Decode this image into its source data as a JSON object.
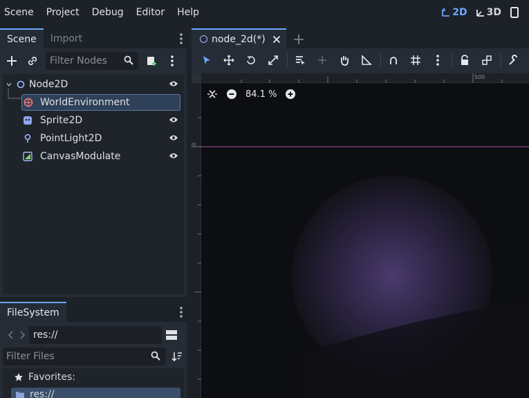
{
  "menu": [
    "Scene",
    "Project",
    "Debug",
    "Editor",
    "Help"
  ],
  "view_modes": {
    "two_d": "2D",
    "three_d": "3D"
  },
  "scene_dock": {
    "tabs": [
      "Scene",
      "Import"
    ],
    "filter_placeholder": "Filter Nodes",
    "nodes": [
      {
        "label": "Node2D",
        "icon": "node2d-icon",
        "visible": true
      },
      {
        "label": "WorldEnvironment",
        "icon": "world-environment-icon",
        "selected": true
      },
      {
        "label": "Sprite2D",
        "icon": "sprite2d-icon",
        "visible": true
      },
      {
        "label": "PointLight2D",
        "icon": "pointlight2d-icon",
        "visible": true
      },
      {
        "label": "CanvasModulate",
        "icon": "canvasmodulate-icon",
        "visible": true
      }
    ]
  },
  "filesystem": {
    "tab": "FileSystem",
    "path": "res://",
    "filter_placeholder": "Filter Files",
    "favorites_label": "Favorites:",
    "root_item": "res://"
  },
  "editor": {
    "scene_tab": "node_2d(*)",
    "zoom": "84.1 %",
    "ruler_top_label": "500",
    "ruler_left_label": "0"
  },
  "colors": {
    "accent": "#6aa8ff",
    "background": "#1d2229",
    "panel": "#262c35",
    "selection": "#2f4158",
    "canvas": "#0f1014",
    "glow": "#4a3a6e"
  }
}
